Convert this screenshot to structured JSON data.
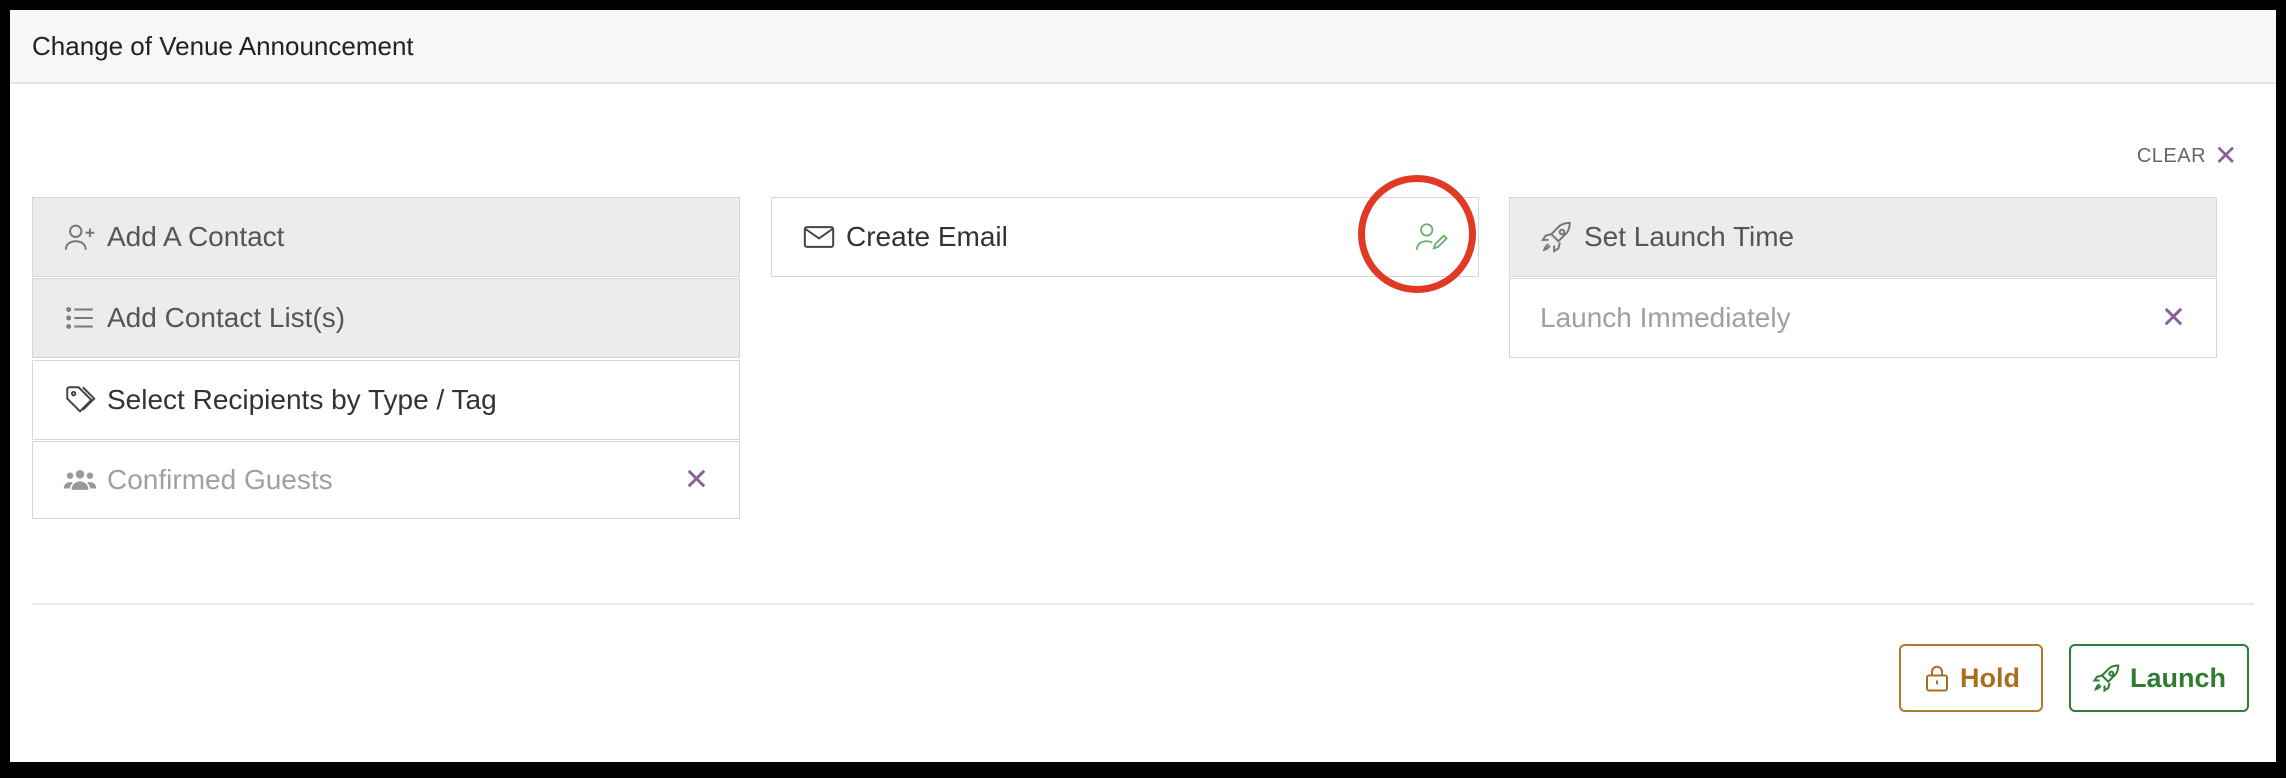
{
  "header": {
    "title": "Change of Venue Announcement"
  },
  "clear": {
    "label": "CLEAR",
    "icon": "close-icon"
  },
  "recipients": {
    "add_contact": {
      "label": "Add A Contact",
      "icon": "user-plus-icon"
    },
    "add_list": {
      "label": "Add Contact List(s)",
      "icon": "list-icon"
    },
    "select_by_tag": {
      "label": "Select Recipients by Type / Tag",
      "icon": "tag-icon"
    },
    "selected_group": {
      "label": "Confirmed Guests",
      "icon": "users-icon",
      "remove_icon": "close-icon"
    }
  },
  "email": {
    "label": "Create Email",
    "icon": "envelope-icon",
    "edit_icon": "user-edit-icon"
  },
  "launch_time": {
    "label": "Set Launch Time",
    "icon": "rocket-icon",
    "value": "Launch Immediately",
    "remove_icon": "close-icon"
  },
  "actions": {
    "hold": {
      "label": "Hold",
      "icon": "lock-icon"
    },
    "launch": {
      "label": "Launch",
      "icon": "rocket-icon"
    }
  },
  "colors": {
    "accent_purple": "#8a5f9e",
    "hold": "#a8701e",
    "launch": "#2e7d32",
    "highlight": "#e03a27",
    "edit_icon": "#6fae6f"
  }
}
